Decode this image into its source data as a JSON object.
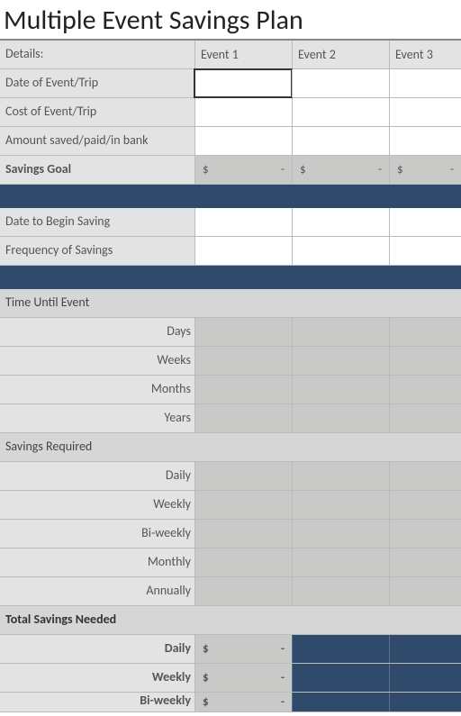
{
  "title": "Multiple Event Savings Plan",
  "header": {
    "details": "Details:",
    "events": [
      "Event 1",
      "Event 2",
      "Event 3"
    ]
  },
  "top_rows": [
    {
      "label": "Date of Event/Trip"
    },
    {
      "label": "Cost of Event/Trip"
    },
    {
      "label": "Amount saved/paid/in bank"
    }
  ],
  "savings_goal_label": "Savings Goal",
  "currency_symbol": "$",
  "currency_dash": "-",
  "after_navy_rows": [
    {
      "label": "Date to Begin Saving"
    },
    {
      "label": "Frequency of Savings"
    }
  ],
  "time_section": {
    "label": "Time Until Event",
    "rows": [
      "Days",
      "Weeks",
      "Months",
      "Years"
    ]
  },
  "savings_required": {
    "label": "Savings Required",
    "rows": [
      "Daily",
      "Weekly",
      "Bi-weekly",
      "Monthly",
      "Annually"
    ]
  },
  "total_savings": {
    "label": "Total Savings Needed",
    "rows": [
      "Daily",
      "Weekly",
      "Bi-weekly"
    ]
  }
}
